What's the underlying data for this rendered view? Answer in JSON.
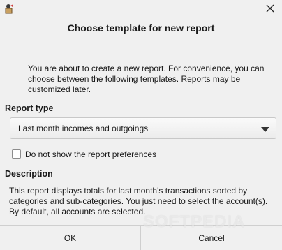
{
  "window": {
    "app_icon": "app-icon",
    "close_icon": "close-icon"
  },
  "dialog": {
    "title": "Choose template for new report",
    "intro": "You are about to create a new report. For convenience, you can choose between the following templates.  Reports may be customized later."
  },
  "report_type": {
    "label": "Report type",
    "selected": "Last month incomes and outgoings"
  },
  "preferences": {
    "checkbox_label": "Do not show the report preferences",
    "checked": false
  },
  "description": {
    "label": "Description",
    "text": "This report displays totals for last month's transactions sorted by categories and sub-categories. You just need to select the account(s). By default, all accounts are selected."
  },
  "buttons": {
    "ok": "OK",
    "cancel": "Cancel"
  },
  "watermark": "SOFTPEDIA"
}
